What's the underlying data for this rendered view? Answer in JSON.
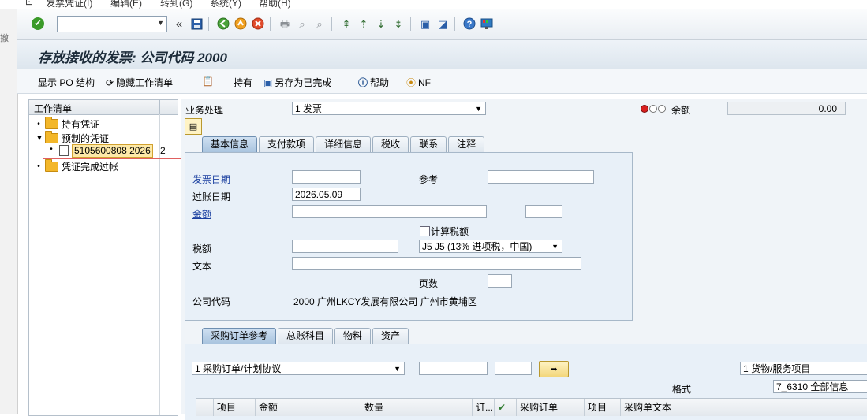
{
  "menu": [
    "发票凭证(I)",
    "编辑(E)",
    "转到(G)",
    "系统(Y)",
    "帮助(H)"
  ],
  "left_strip_label": "撤",
  "toolbar": {
    "command_field_value": "",
    "back_double_chevron": "«"
  },
  "title": "存放接收的发票: 公司代码 2000",
  "app_toolbar": {
    "show_po_structure": "显示 PO 结构",
    "hide_worklist": "隐藏工作清单",
    "hold": "持有",
    "save_as_completed": "另存为已完成",
    "help": "帮助",
    "nf": "NF"
  },
  "worklist": {
    "header": "工作清单",
    "nodes": [
      {
        "label": "持有凭证"
      },
      {
        "label": "预制的凭证"
      },
      {
        "label": "凭证完成过帐"
      }
    ],
    "selected_doc": {
      "number": "5105600808 2026",
      "count": "2"
    }
  },
  "business": {
    "label": "业务处理",
    "value": "1 发票",
    "balance_label": "余额",
    "balance_value": "0.00",
    "status_color_red": "#d81f1f"
  },
  "header_tabs": [
    "基本信息",
    "支付款项",
    "详细信息",
    "税收",
    "联系",
    "注释"
  ],
  "basic": {
    "invoice_date_label": "发票日期",
    "invoice_date_value": "",
    "reference_label": "参考",
    "reference_value": "",
    "posting_date_label": "过账日期",
    "posting_date_value": "2026.05.09",
    "amount_label": "金额",
    "amount_value": "",
    "currency_value": "",
    "calc_tax_label": "计算税额",
    "calc_tax_checked": false,
    "tax_amount_label": "税额",
    "tax_amount_value": "",
    "tax_code_value": "J5 J5 (13% 进项税，中国)",
    "text_label": "文本",
    "text_value": "",
    "pages_label": "页数",
    "pages_value": "",
    "company_code_label": "公司代码",
    "company_code_value": "2000 广州LKCY发展有限公司 广州市黄埔区"
  },
  "item_tabs": [
    "采购订单参考",
    "总账科目",
    "物料",
    "资产"
  ],
  "po_ref": {
    "ref_type_value": "1 采购订单/计划协议",
    "po_number_value": "",
    "po_item_value": "",
    "item_type_value": "1 货物/服务项目",
    "layout_label": "格式",
    "layout_value": "7_6310 全部信息"
  },
  "item_table_headers": [
    "项目",
    "金额",
    "数量",
    "订...",
    "",
    "采购订单",
    "项目",
    "采购单文本"
  ]
}
